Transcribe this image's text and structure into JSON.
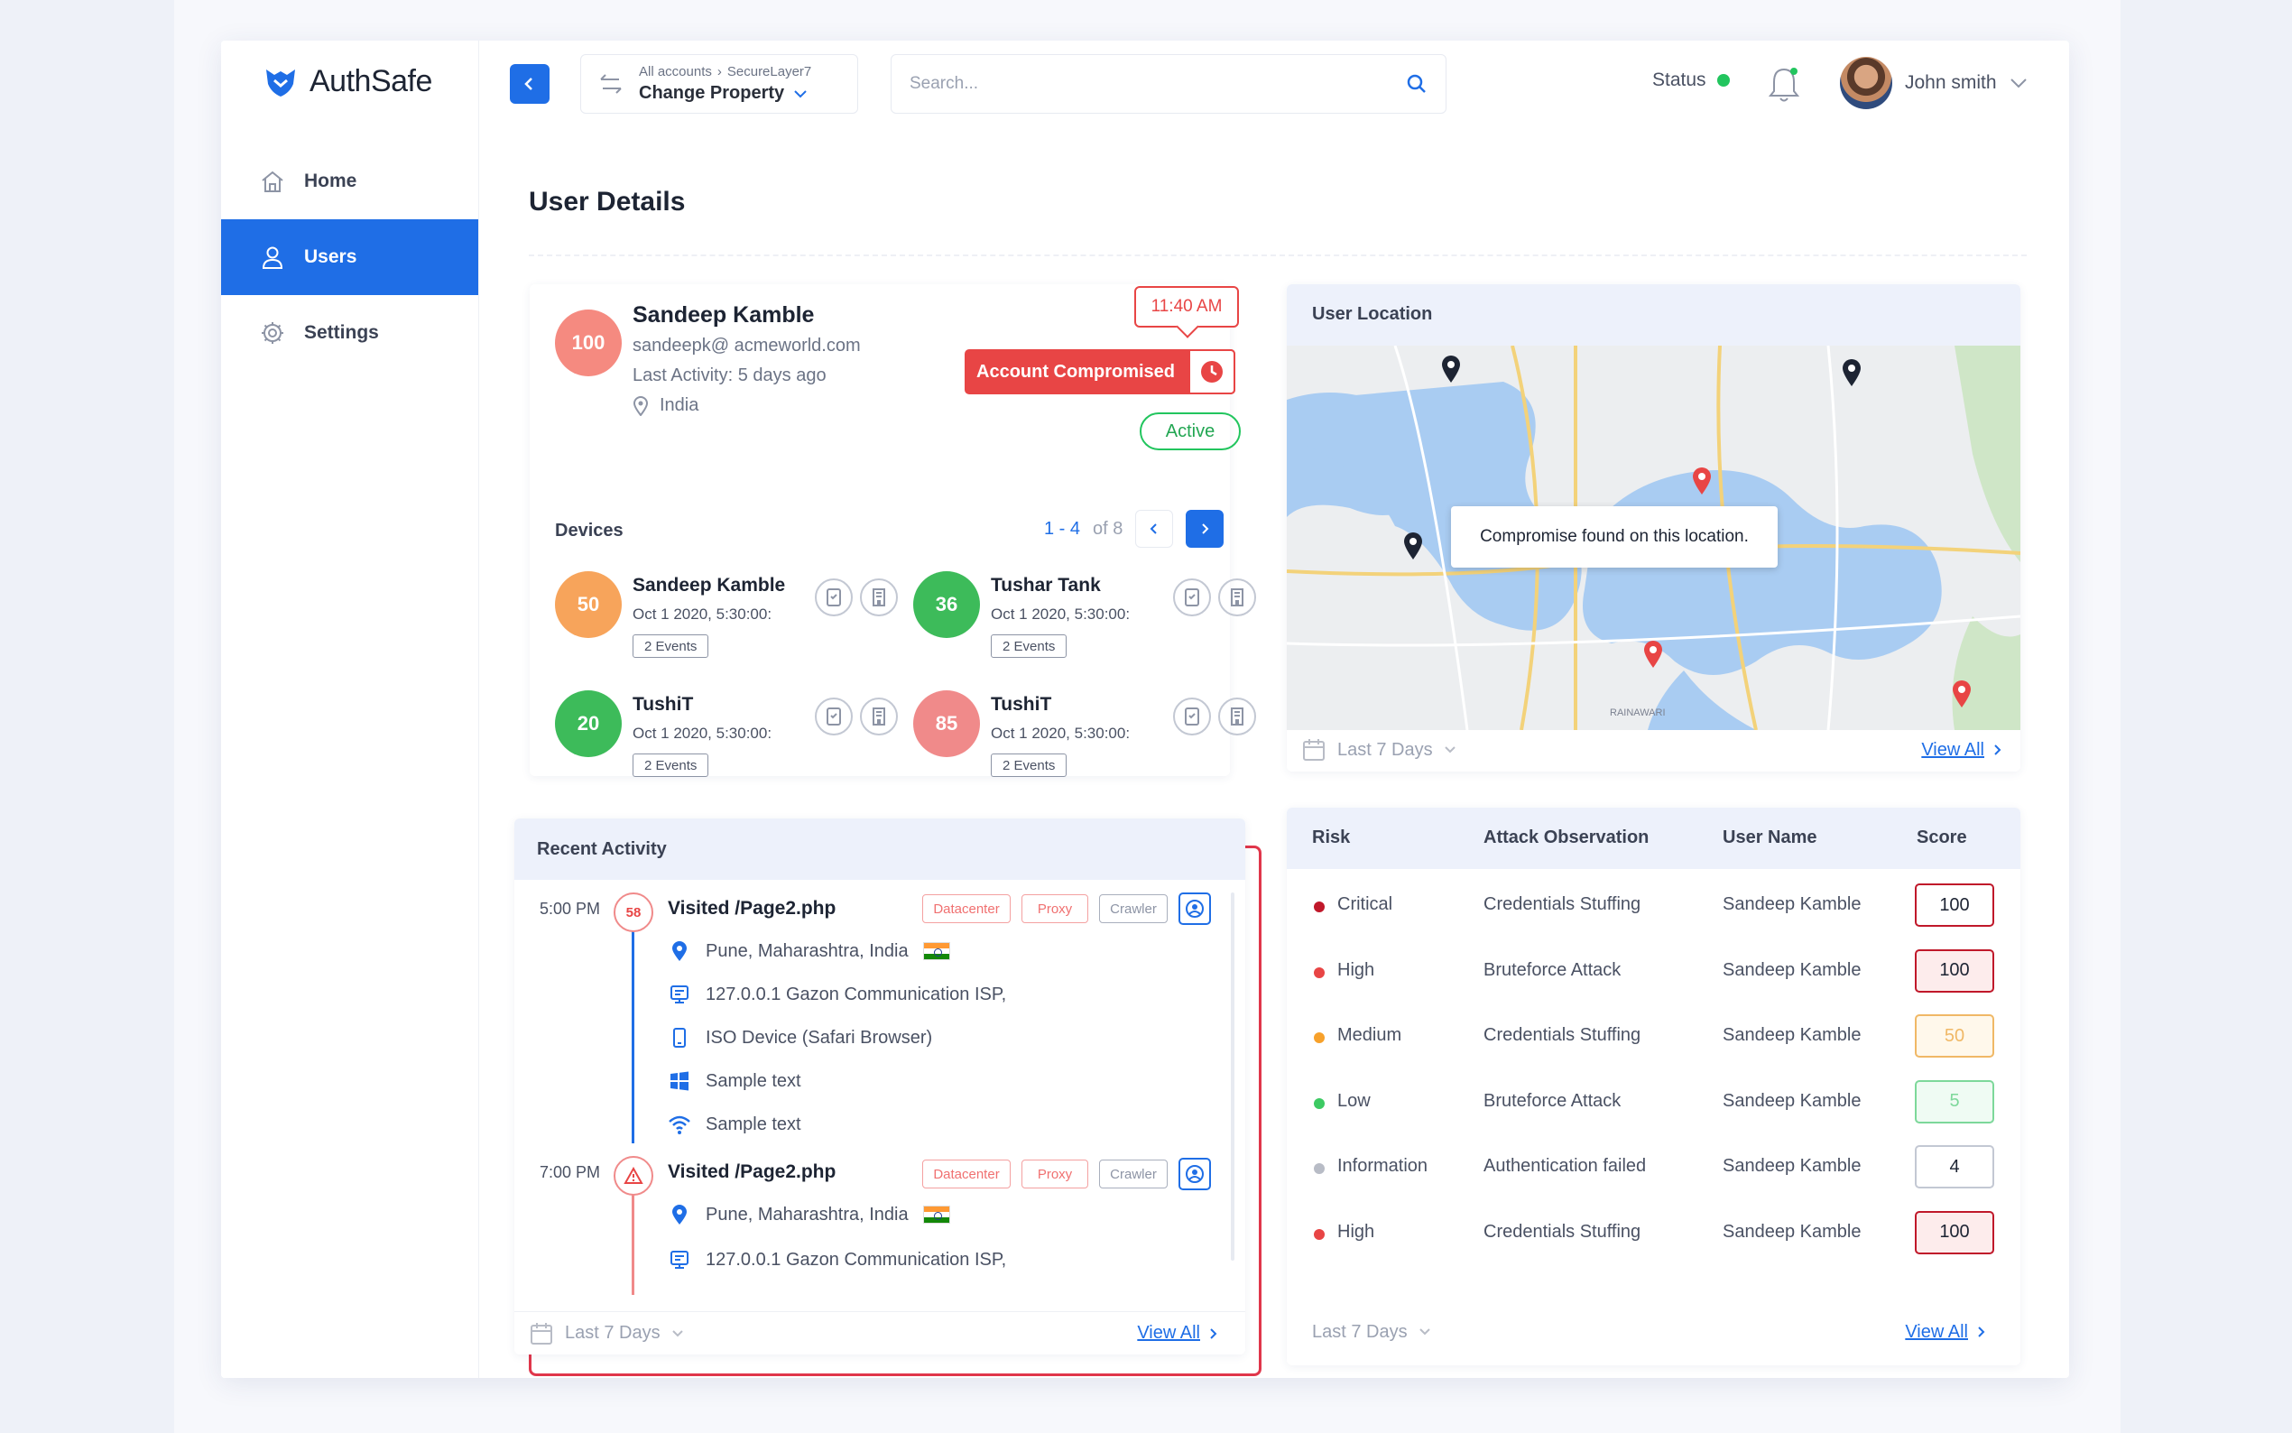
{
  "brand": {
    "name": "AuthSafe"
  },
  "sidebar": {
    "items": [
      {
        "label": "Home",
        "icon": "home-icon"
      },
      {
        "label": "Users",
        "icon": "user-icon",
        "active": true
      },
      {
        "label": "Settings",
        "icon": "gear-icon"
      }
    ]
  },
  "header": {
    "breadcrumb": [
      "All accounts",
      "SecureLayer7"
    ],
    "property_label": "Change Property",
    "search_placeholder": "Search...",
    "status_label": "Status",
    "user_name": "John smith"
  },
  "page": {
    "title": "User Details"
  },
  "profile": {
    "score": "100",
    "name": "Sandeep Kamble",
    "email": "sandeepk@ acmeworld.com",
    "last_activity": "Last Activity: 5 days ago",
    "country": "India",
    "time_badge": "11:40 AM",
    "compromised_label": "Account Compromised",
    "status_label": "Active"
  },
  "devices": {
    "label": "Devices",
    "range": "1 - 4",
    "total": "of 8",
    "items": [
      {
        "score": "50",
        "color": "#f7a45b",
        "name": "Sandeep Kamble",
        "date": "Oct 1 2020, 5:30:00:",
        "events": "2 Events"
      },
      {
        "score": "36",
        "color": "#3dbb5a",
        "name": "Tushar Tank",
        "date": "Oct 1 2020, 5:30:00:",
        "events": "2 Events"
      },
      {
        "score": "20",
        "color": "#3dbb5a",
        "name": "TushiT",
        "date": "Oct 1 2020, 5:30:00:",
        "events": "2 Events"
      },
      {
        "score": "85",
        "color": "#f08a8a",
        "name": "TushiT",
        "date": "Oct 1 2020, 5:30:00:",
        "events": "2 Events"
      }
    ]
  },
  "location": {
    "title": "User Location",
    "tooltip": "Compromise found on this location.",
    "map_labels": [
      "RAINAWARI"
    ],
    "filter": "Last 7 Days",
    "view_all": "View All"
  },
  "activity": {
    "title": "Recent Activity",
    "entries": [
      {
        "time": "5:00 PM",
        "node": "58",
        "title": "Visited /Page2.php",
        "tags": [
          "Datacenter",
          "Proxy",
          "Crawler"
        ],
        "location": "Pune, Maharashtra, India",
        "isp": "127.0.0.1 Gazon Communication ISP,",
        "device": "ISO Device (Safari Browser)",
        "os": "Sample text",
        "network": "Sample text"
      },
      {
        "time": "7:00 PM",
        "node": "!",
        "title": "Visited /Page2.php",
        "tags": [
          "Datacenter",
          "Proxy",
          "Crawler"
        ],
        "location": "Pune, Maharashtra, India",
        "isp": "127.0.0.1 Gazon Communication ISP,"
      }
    ],
    "filter": "Last 7 Days",
    "view_all": "View All"
  },
  "risk_table": {
    "headers": [
      "Risk",
      "Attack Observation",
      "User Name",
      "Score"
    ],
    "rows": [
      {
        "risk": "Critical",
        "dot": "#c0182a",
        "observation": "Credentials Stuffing",
        "user": "Sandeep Kamble",
        "score": "100",
        "score_color": "#c0182a",
        "score_bg": "#fff"
      },
      {
        "risk": "High",
        "dot": "#e84545",
        "observation": "Bruteforce Attack",
        "user": "Sandeep Kamble",
        "score": "100",
        "score_color": "#c0182a",
        "score_bg": "#fdecec"
      },
      {
        "risk": "Medium",
        "dot": "#f7a12b",
        "observation": "Credentials Stuffing",
        "user": "Sandeep Kamble",
        "score": "50",
        "score_color": "#f0b866",
        "score_bg": "#fff8eb"
      },
      {
        "risk": "Low",
        "dot": "#3dca63",
        "observation": "Bruteforce Attack",
        "user": "Sandeep Kamble",
        "score": "5",
        "score_color": "#7dd89a",
        "score_bg": "#effbf3"
      },
      {
        "risk": "Information",
        "dot": "#b8bcc6",
        "observation": "Authentication failed",
        "user": "Sandeep Kamble",
        "score": "4",
        "score_color": "#c3c8d3",
        "score_bg": "#fff"
      },
      {
        "risk": "High",
        "dot": "#e84545",
        "observation": "Credentials Stuffing",
        "user": "Sandeep Kamble",
        "score": "100",
        "score_color": "#c0182a",
        "score_bg": "#fdecec"
      }
    ],
    "filter": "Last 7 Days",
    "view_all": "View All"
  }
}
